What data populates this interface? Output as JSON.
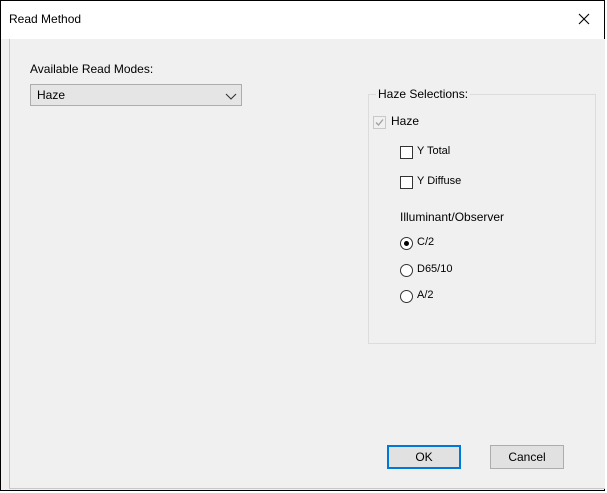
{
  "window": {
    "title": "Read Method",
    "close_glyph": "×"
  },
  "read_modes": {
    "label": "Available Read Modes:",
    "selected": "Haze"
  },
  "haze_group": {
    "title": "Haze Selections:",
    "haze_checkbox": {
      "label": "Haze",
      "checked": true,
      "enabled": false
    },
    "y_total": {
      "label": "Y Total",
      "checked": false
    },
    "y_diffuse": {
      "label": "Y Diffuse",
      "checked": false
    },
    "illuminant_label": "Illuminant/Observer",
    "illuminants": [
      {
        "label": "C/2",
        "selected": true
      },
      {
        "label": "D65/10",
        "selected": false
      },
      {
        "label": "A/2",
        "selected": false
      }
    ]
  },
  "buttons": {
    "ok": "OK",
    "cancel": "Cancel"
  },
  "colors": {
    "accent": "#0078d7",
    "dialog_bg": "#f0f0f0",
    "disabled": "#a0a0a0"
  }
}
